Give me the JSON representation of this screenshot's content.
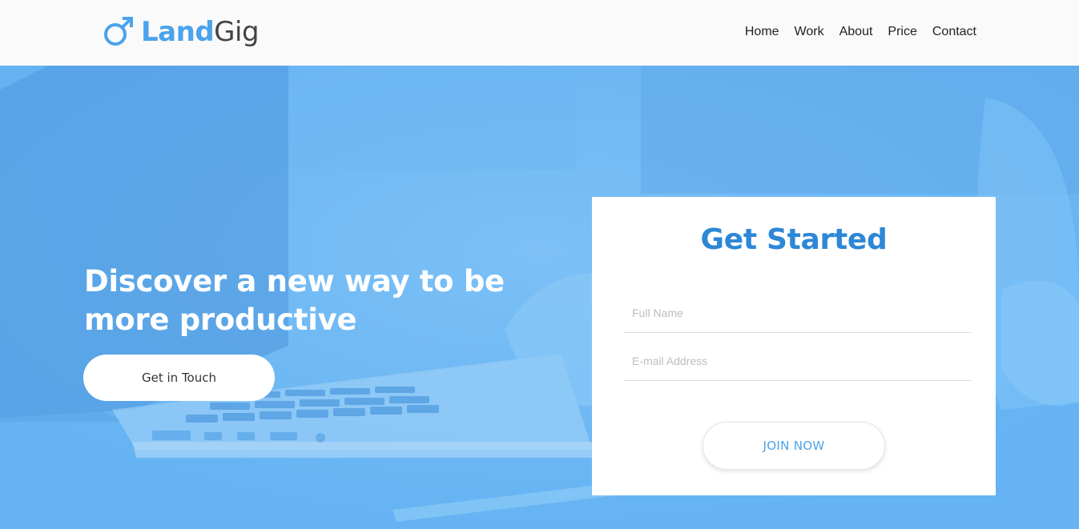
{
  "brand": {
    "part1": "Land",
    "part2": "Gig",
    "icon": "male-symbol-icon"
  },
  "nav": {
    "items": [
      {
        "label": "Home"
      },
      {
        "label": "Work"
      },
      {
        "label": "About"
      },
      {
        "label": "Price"
      },
      {
        "label": "Contact"
      }
    ]
  },
  "hero": {
    "headline": "Discover a new way to be more productive",
    "cta_label": "Get in Touch"
  },
  "form": {
    "title": "Get Started",
    "name_placeholder": "Full Name",
    "email_placeholder": "E-mail Address",
    "submit_label": "JOIN NOW"
  },
  "colors": {
    "accent": "#4aa3ec",
    "hero_bg": "#65b3f3",
    "title": "#2d87d6"
  }
}
